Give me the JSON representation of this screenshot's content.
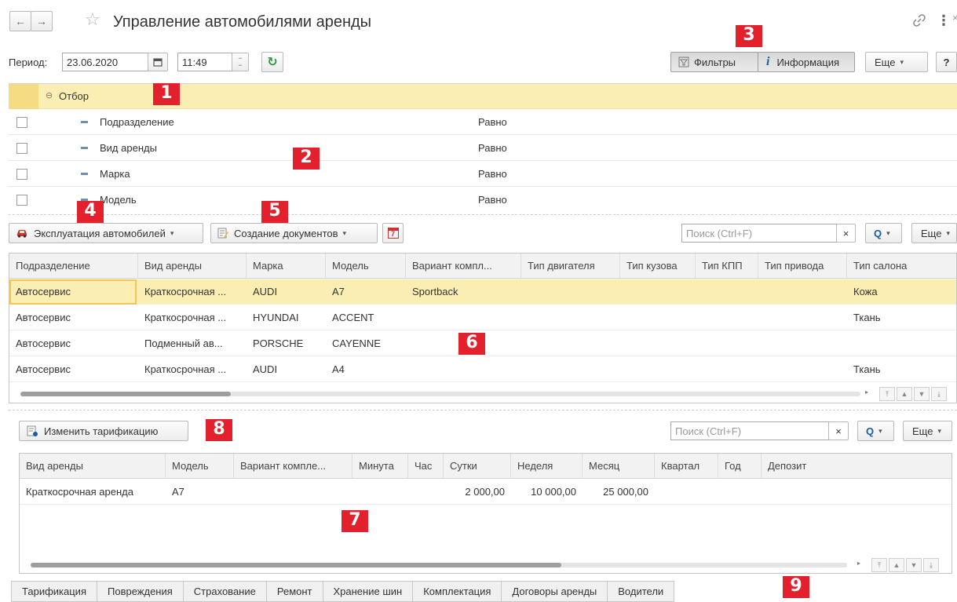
{
  "window": {
    "title": "Управление автомобилями аренды",
    "back_icon": "arrow-left-icon",
    "forward_icon": "arrow-right-icon",
    "favorite_icon": "star-icon",
    "link_icon": "link-icon",
    "more_icon": "more-vertical-icon"
  },
  "period": {
    "label": "Период:",
    "date": "23.06.2020",
    "time": "11:49"
  },
  "toolbar": {
    "filters_label": "Фильтры",
    "info_label": "Информация",
    "more_label": "Еще",
    "help_label": "?"
  },
  "filter": {
    "header": "Отбор",
    "rows": [
      {
        "field": "Подразделение",
        "condition": "Равно"
      },
      {
        "field": "Вид аренды",
        "condition": "Равно"
      },
      {
        "field": "Марка",
        "condition": "Равно"
      },
      {
        "field": "Модель",
        "condition": "Равно"
      }
    ]
  },
  "cars_toolbar": {
    "exploitation_label": "Эксплуатация автомобилей",
    "create_docs_label": "Создание документов",
    "calendar_badge": "7",
    "search_placeholder": "Поиск (Ctrl+F)",
    "clear_label": "×",
    "more_label": "Еще"
  },
  "cars_table": {
    "columns": [
      "Подразделение",
      "Вид аренды",
      "Марка",
      "Модель",
      "Вариант компл...",
      "Тип двигателя",
      "Тип кузова",
      "Тип КПП",
      "Тип привода",
      "Тип салона"
    ],
    "rows": [
      [
        "Автосервис",
        "Краткосрочная ...",
        "AUDI",
        "A7",
        "Sportback",
        "",
        "",
        "",
        "",
        "Кожа"
      ],
      [
        "Автосервис",
        "Краткосрочная ...",
        "HYUNDAI",
        "ACCENT",
        "",
        "",
        "",
        "",
        "",
        "Ткань"
      ],
      [
        "Автосервис",
        "Подменный ав...",
        "PORSCHE",
        "CAYENNE",
        "",
        "",
        "",
        "",
        "",
        ""
      ],
      [
        "Автосервис",
        "Краткосрочная ...",
        "AUDI",
        "A4",
        "",
        "",
        "",
        "",
        "",
        "Ткань"
      ]
    ],
    "selected_row": 0,
    "scroll_fraction": 0.25
  },
  "tariff_toolbar": {
    "change_label": "Изменить тарификацию",
    "search_placeholder": "Поиск (Ctrl+F)",
    "clear_label": "×",
    "more_label": "Еще"
  },
  "tariff_table": {
    "columns": [
      "Вид аренды",
      "Модель",
      "Вариант компле...",
      "Минута",
      "Час",
      "Сутки",
      "Неделя",
      "Месяц",
      "Квартал",
      "Год",
      "Депозит"
    ],
    "rows": [
      [
        "Краткосрочная аренда",
        "A7",
        "",
        "",
        "",
        "2 000,00",
        "10 000,00",
        "25 000,00",
        "",
        "",
        ""
      ]
    ],
    "scroll_fraction": 0.65
  },
  "tabs": [
    "Тарификация",
    "Повреждения",
    "Страхование",
    "Ремонт",
    "Хранение шин",
    "Комплектация",
    "Договоры аренды",
    "Водители"
  ],
  "active_tab": 0,
  "badges": [
    "1",
    "2",
    "3",
    "4",
    "5",
    "6",
    "7",
    "8",
    "9"
  ],
  "colors": {
    "selection": "#fbeeb3",
    "badge": "#e3212d",
    "refresh": "#2e9b3a"
  }
}
